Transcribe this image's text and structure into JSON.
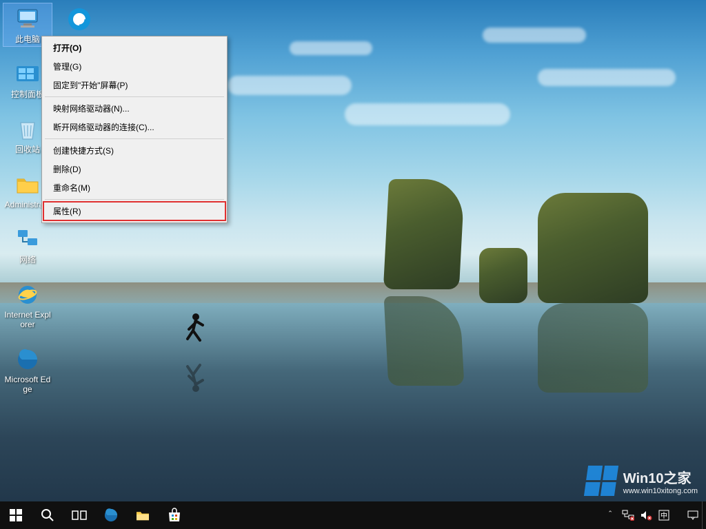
{
  "desktop_icons": {
    "this_pc": "此电脑",
    "control_panel": "控制面板",
    "recycle_bin": "回收站",
    "admin_folder": "Administra...",
    "network": "网络",
    "ie": "Internet Explorer",
    "edge": "Microsoft Edge",
    "tencent": ""
  },
  "context_menu": {
    "open": "打开(O)",
    "manage": "管理(G)",
    "pin_start": "固定到\"开始\"屏幕(P)",
    "map_drive": "映射网络驱动器(N)...",
    "disconnect_drive": "断开网络驱动器的连接(C)...",
    "create_shortcut": "创建快捷方式(S)",
    "delete": "删除(D)",
    "rename": "重命名(M)",
    "properties": "属性(R)"
  },
  "taskbar": {
    "tray_chevron": "＾",
    "clock_time": " ",
    "clock_date": " "
  },
  "watermark": {
    "title": "Win10之家",
    "url": "www.win10xitong.com"
  }
}
